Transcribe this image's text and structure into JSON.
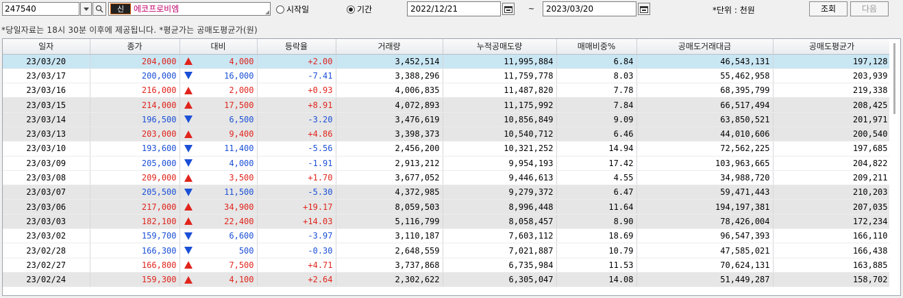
{
  "toolbar": {
    "stock_code": "247540",
    "badge": "신",
    "stock_name": "에코프로비엠",
    "radio_start": "시작일",
    "radio_period": "기간",
    "radio_selected": "period",
    "date_from": "2022/12/21",
    "tilde": "~",
    "date_to": "2023/03/20",
    "unit": "*단위 : 천원",
    "query_label": "조회",
    "next_label": "다음"
  },
  "notice": "*당일자료는 18시 30분 이후에 제공됩니다. *평균가는 공매도평균가(원)",
  "colors": {
    "up": "#e0241c",
    "down": "#1a4fd6",
    "selected": "#c9e6f3",
    "gray_row": "#e6e6e6"
  },
  "table": {
    "headers": [
      "일자",
      "종가",
      "대비",
      "등락율",
      "거래량",
      "누적공매도량",
      "매매비중%",
      "공매도거래대금",
      "공매도평균가"
    ],
    "rows": [
      {
        "date": "23/03/20",
        "close": "204,000",
        "dir": "up",
        "change": "4,000",
        "rate": "+2.00",
        "volume": "3,452,514",
        "cum_short": "11,995,884",
        "ratio": "6.84",
        "short_amount": "46,543,131",
        "short_avg": "197,128",
        "bg": "selected"
      },
      {
        "date": "23/03/17",
        "close": "200,000",
        "dir": "down",
        "change": "16,000",
        "rate": "-7.41",
        "volume": "3,388,296",
        "cum_short": "11,759,778",
        "ratio": "8.03",
        "short_amount": "55,462,958",
        "short_avg": "203,939",
        "bg": "white"
      },
      {
        "date": "23/03/16",
        "close": "216,000",
        "dir": "up",
        "change": "2,000",
        "rate": "+0.93",
        "volume": "4,006,835",
        "cum_short": "11,487,820",
        "ratio": "7.78",
        "short_amount": "68,395,799",
        "short_avg": "219,338",
        "bg": "white"
      },
      {
        "date": "23/03/15",
        "close": "214,000",
        "dir": "up",
        "change": "17,500",
        "rate": "+8.91",
        "volume": "4,072,893",
        "cum_short": "11,175,992",
        "ratio": "7.84",
        "short_amount": "66,517,494",
        "short_avg": "208,425",
        "bg": "gray"
      },
      {
        "date": "23/03/14",
        "close": "196,500",
        "dir": "down",
        "change": "6,500",
        "rate": "-3.20",
        "volume": "3,476,619",
        "cum_short": "10,856,849",
        "ratio": "9.09",
        "short_amount": "63,850,521",
        "short_avg": "201,971",
        "bg": "gray"
      },
      {
        "date": "23/03/13",
        "close": "203,000",
        "dir": "up",
        "change": "9,400",
        "rate": "+4.86",
        "volume": "3,398,373",
        "cum_short": "10,540,712",
        "ratio": "6.46",
        "short_amount": "44,010,606",
        "short_avg": "200,540",
        "bg": "gray"
      },
      {
        "date": "23/03/10",
        "close": "193,600",
        "dir": "down",
        "change": "11,400",
        "rate": "-5.56",
        "volume": "2,456,200",
        "cum_short": "10,321,252",
        "ratio": "14.94",
        "short_amount": "72,562,225",
        "short_avg": "197,685",
        "bg": "white"
      },
      {
        "date": "23/03/09",
        "close": "205,000",
        "dir": "down",
        "change": "4,000",
        "rate": "-1.91",
        "volume": "2,913,212",
        "cum_short": "9,954,193",
        "ratio": "17.42",
        "short_amount": "103,963,665",
        "short_avg": "204,822",
        "bg": "white"
      },
      {
        "date": "23/03/08",
        "close": "209,000",
        "dir": "up",
        "change": "3,500",
        "rate": "+1.70",
        "volume": "3,677,052",
        "cum_short": "9,446,613",
        "ratio": "4.55",
        "short_amount": "34,988,720",
        "short_avg": "209,211",
        "bg": "white"
      },
      {
        "date": "23/03/07",
        "close": "205,500",
        "dir": "down",
        "change": "11,500",
        "rate": "-5.30",
        "volume": "4,372,985",
        "cum_short": "9,279,372",
        "ratio": "6.47",
        "short_amount": "59,471,443",
        "short_avg": "210,203",
        "bg": "gray"
      },
      {
        "date": "23/03/06",
        "close": "217,000",
        "dir": "up",
        "change": "34,900",
        "rate": "+19.17",
        "volume": "8,059,503",
        "cum_short": "8,996,448",
        "ratio": "11.64",
        "short_amount": "194,197,381",
        "short_avg": "207,035",
        "bg": "gray"
      },
      {
        "date": "23/03/03",
        "close": "182,100",
        "dir": "up",
        "change": "22,400",
        "rate": "+14.03",
        "volume": "5,116,799",
        "cum_short": "8,058,457",
        "ratio": "8.90",
        "short_amount": "78,426,004",
        "short_avg": "172,234",
        "bg": "gray"
      },
      {
        "date": "23/03/02",
        "close": "159,700",
        "dir": "down",
        "change": "6,600",
        "rate": "-3.97",
        "volume": "3,110,187",
        "cum_short": "7,603,112",
        "ratio": "18.69",
        "short_amount": "96,547,393",
        "short_avg": "166,110",
        "bg": "white"
      },
      {
        "date": "23/02/28",
        "close": "166,300",
        "dir": "down",
        "change": "500",
        "rate": "-0.30",
        "volume": "2,648,559",
        "cum_short": "7,021,887",
        "ratio": "10.79",
        "short_amount": "47,585,021",
        "short_avg": "166,438",
        "bg": "white"
      },
      {
        "date": "23/02/27",
        "close": "166,800",
        "dir": "up",
        "change": "7,500",
        "rate": "+4.71",
        "volume": "3,737,868",
        "cum_short": "6,735,984",
        "ratio": "11.53",
        "short_amount": "70,624,131",
        "short_avg": "163,885",
        "bg": "white"
      },
      {
        "date": "23/02/24",
        "close": "159,300",
        "dir": "up",
        "change": "4,100",
        "rate": "+2.64",
        "volume": "2,302,622",
        "cum_short": "6,305,047",
        "ratio": "14.08",
        "short_amount": "51,449,287",
        "short_avg": "158,702",
        "bg": "gray"
      }
    ]
  }
}
